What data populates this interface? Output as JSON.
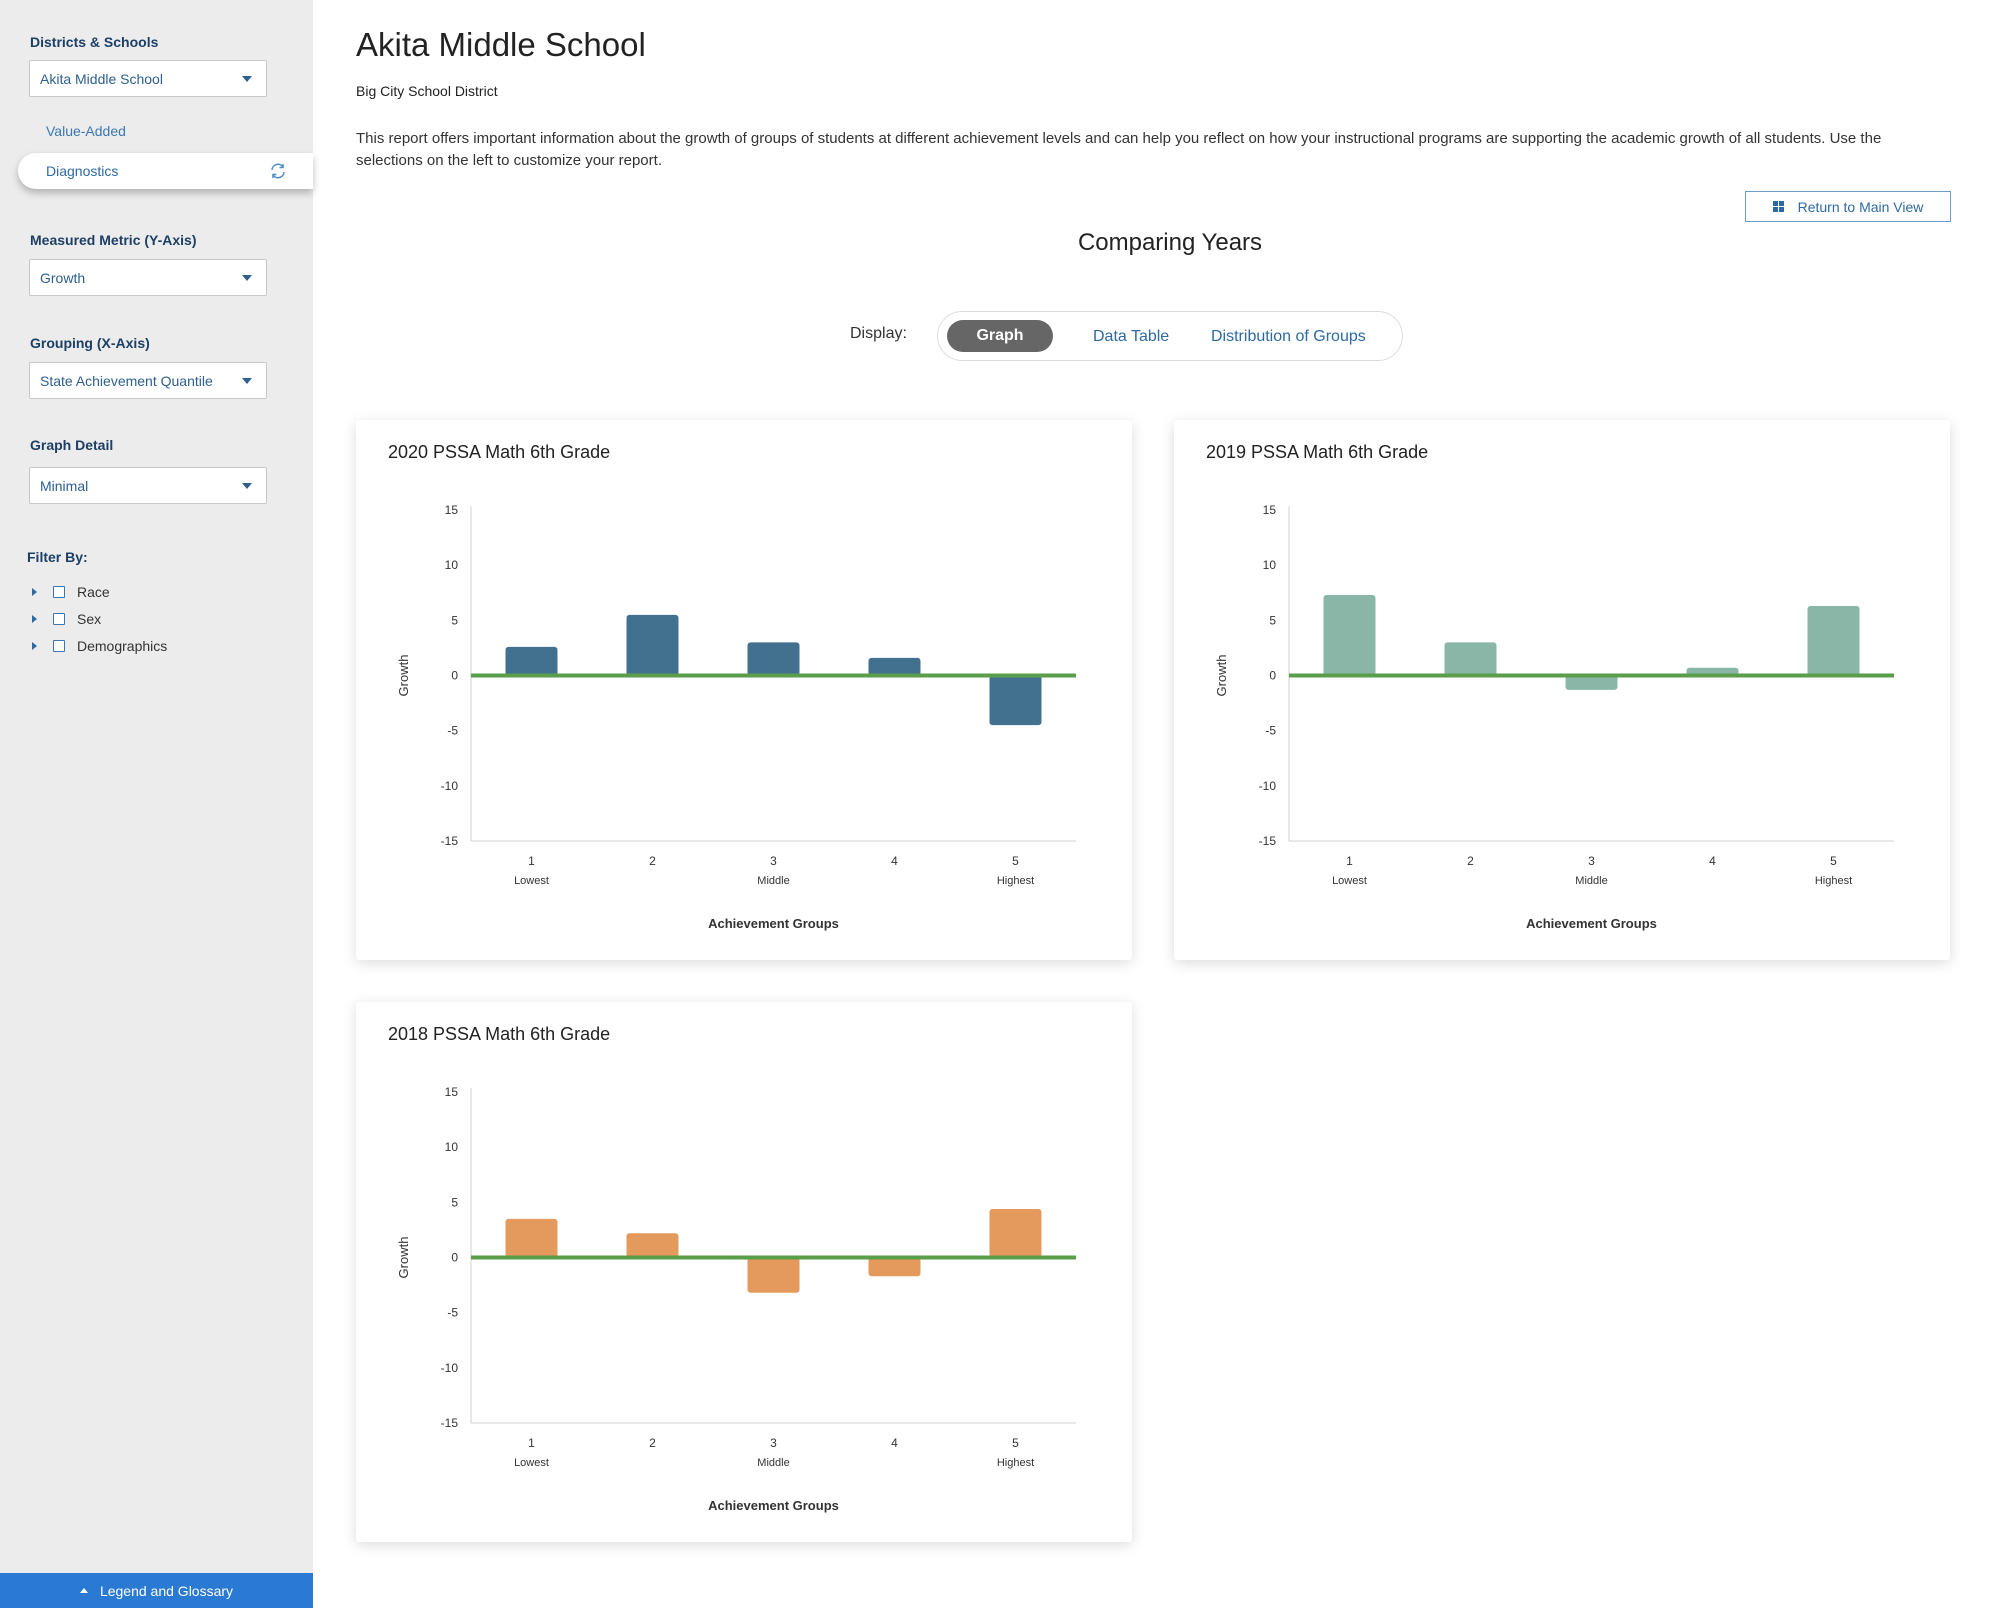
{
  "sidebar": {
    "districts_label": "Districts & Schools",
    "school_select": "Akita Middle School",
    "nav_value_added": "Value-Added",
    "nav_diagnostics": "Diagnostics",
    "metric_label": "Measured Metric (Y-Axis)",
    "metric_select": "Growth",
    "grouping_label": "Grouping (X-Axis)",
    "grouping_select": "State Achievement Quantile",
    "detail_label": "Graph Detail",
    "detail_select": "Minimal",
    "filter_label": "Filter By:",
    "filters": [
      "Race",
      "Sex",
      "Demographics"
    ],
    "legend_button": "Legend and Glossary"
  },
  "header": {
    "title": "Akita Middle School",
    "district": "Big City School District",
    "description": "This report offers important information about the growth of groups of students at different achievement levels and can help you reflect on how your instructional programs are supporting the academic growth of all students. Use the selections on the left to customize your report.",
    "return_button": "Return to Main View",
    "section_title": "Comparing Years",
    "display_label": "Display:",
    "display_options": [
      "Graph",
      "Data Table",
      "Distribution of Groups"
    ]
  },
  "colors": {
    "bar_2020": "#42708f",
    "bar_2019": "#8ab6a8",
    "bar_2018": "#e39a5c",
    "zero_line": "#5a9e4a",
    "accent": "#2a7ad3"
  },
  "chart_data": [
    {
      "type": "bar",
      "title": "2020 PSSA Math 6th Grade",
      "categories": [
        "1",
        "2",
        "3",
        "4",
        "5"
      ],
      "category_sublabels": [
        "Lowest",
        "",
        "Middle",
        "",
        "Highest"
      ],
      "values": [
        2.6,
        5.5,
        3.0,
        1.6,
        -4.5
      ],
      "xlabel": "Achievement Groups",
      "ylabel": "Growth",
      "ylim": [
        -15,
        15
      ],
      "yticks": [
        15,
        10,
        5,
        0,
        -5,
        -10,
        -15
      ]
    },
    {
      "type": "bar",
      "title": "2019 PSSA Math 6th Grade",
      "categories": [
        "1",
        "2",
        "3",
        "4",
        "5"
      ],
      "category_sublabels": [
        "Lowest",
        "",
        "Middle",
        "",
        "Highest"
      ],
      "values": [
        7.3,
        3.0,
        -1.3,
        0.7,
        6.3
      ],
      "xlabel": "Achievement Groups",
      "ylabel": "Growth",
      "ylim": [
        -15,
        15
      ],
      "yticks": [
        15,
        10,
        5,
        0,
        -5,
        -10,
        -15
      ]
    },
    {
      "type": "bar",
      "title": "2018 PSSA Math 6th Grade",
      "categories": [
        "1",
        "2",
        "3",
        "4",
        "5"
      ],
      "category_sublabels": [
        "Lowest",
        "",
        "Middle",
        "",
        "Highest"
      ],
      "values": [
        3.5,
        2.2,
        -3.2,
        -1.7,
        4.4
      ],
      "xlabel": "Achievement Groups",
      "ylabel": "Growth",
      "ylim": [
        -15,
        15
      ],
      "yticks": [
        15,
        10,
        5,
        0,
        -5,
        -10,
        -15
      ]
    }
  ]
}
